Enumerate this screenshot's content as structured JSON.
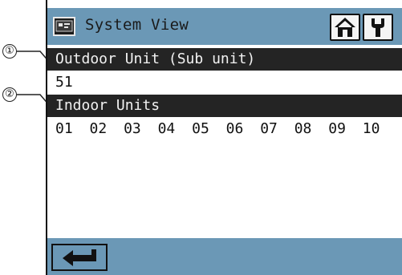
{
  "callouts": [
    "①",
    "②"
  ],
  "titlebar": {
    "title": "System View",
    "app_icon": "system-view-icon",
    "home_icon": "home-icon",
    "settings_icon": "wrench-icon"
  },
  "outdoor": {
    "header": "Outdoor Unit (Sub unit)",
    "units": [
      "51"
    ]
  },
  "indoor": {
    "header": "Indoor Units",
    "units": [
      "01",
      "02",
      "03",
      "04",
      "05",
      "06",
      "07",
      "08",
      "09",
      "10"
    ]
  },
  "footer": {
    "back_icon": "return-arrow-icon"
  },
  "colors": {
    "bar": "#6b98b6",
    "header_bg": "#242424",
    "header_text": "#f2f2f2"
  }
}
